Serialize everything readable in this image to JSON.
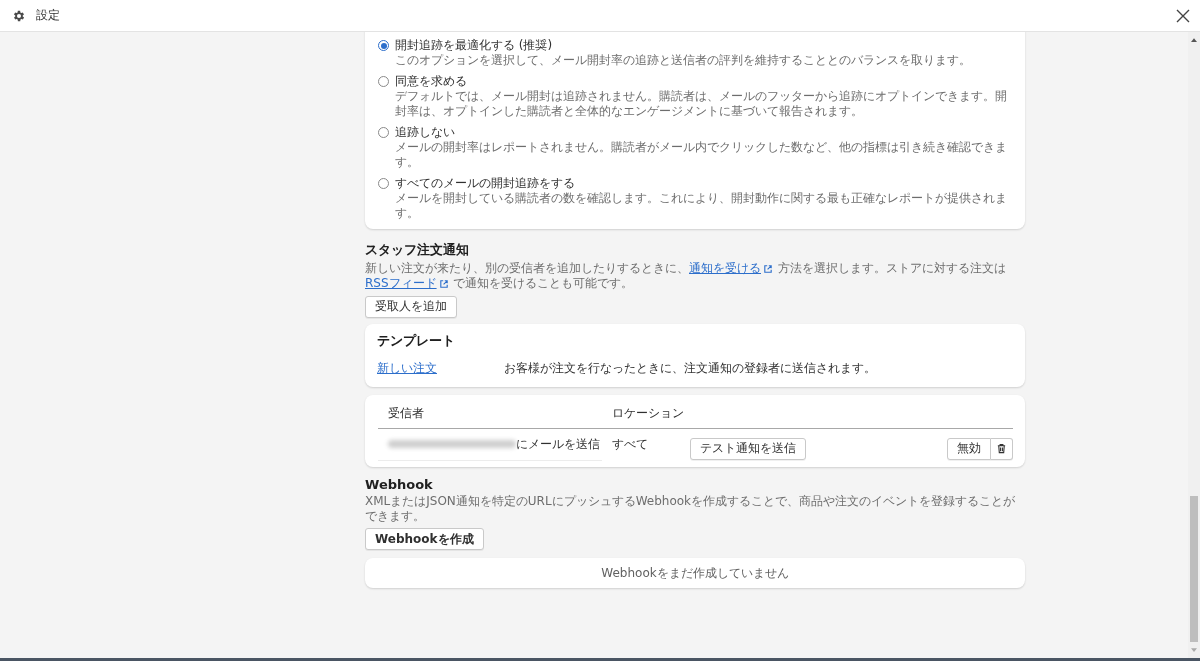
{
  "window": {
    "title": "設定"
  },
  "open_tracking": {
    "options": [
      {
        "label": "開封追跡を最適化する (推奨)",
        "description": "このオプションを選択して、メール開封率の追跡と送信者の評判を維持することとのバランスを取ります。",
        "selected": true
      },
      {
        "label": "同意を求める",
        "description": "デフォルトでは、メール開封は追跡されません。購読者は、メールのフッターから追跡にオプトインできます。開封率は、オプトインした購読者と全体的なエンゲージメントに基づいて報告されます。",
        "selected": false
      },
      {
        "label": "追跡しない",
        "description": "メールの開封率はレポートされません。購読者がメール内でクリックした数など、他の指標は引き続き確認できます。",
        "selected": false
      },
      {
        "label": "すべてのメールの開封追跡をする",
        "description": "メールを開封している購読者の数を確認します。これにより、開封動作に関する最も正確なレポートが提供されます。",
        "selected": false
      }
    ]
  },
  "staff_notifications": {
    "title": "スタッフ注文通知",
    "description": [
      {
        "kind": "text",
        "text": "新しい注文が来たり、別の受信者を追加したりするときに、"
      },
      {
        "kind": "link",
        "text": "通知を受ける"
      },
      {
        "kind": "text",
        "text": " 方法を選択します。ストアに対する注文は"
      },
      {
        "kind": "link",
        "text": "RSSフィード"
      },
      {
        "kind": "text",
        "text": " で通知を受けることも可能です。"
      }
    ],
    "add_button": "受取人を追加"
  },
  "templates": {
    "title": "テンプレート",
    "items": [
      {
        "name": "新しい注文",
        "description": "お客様が注文を行なったときに、注文通知の登録者に送信されます。"
      }
    ]
  },
  "recipients": {
    "columns": [
      "受信者",
      "ロケーション"
    ],
    "rows": [
      {
        "address_hidden": true,
        "recipient": "にメールを送信",
        "location": "すべて",
        "test_button": "テスト通知を送信",
        "disable_button": "無効"
      }
    ]
  },
  "webhooks": {
    "title": "Webhook",
    "description": "XMLまたはJSON通知を特定のURLにプッシュするWebhookを作成することで、商品や注文のイベントを登録することができます。",
    "create_button": "Webhookを作成",
    "empty_message": "Webhookをまだ作成していません"
  }
}
